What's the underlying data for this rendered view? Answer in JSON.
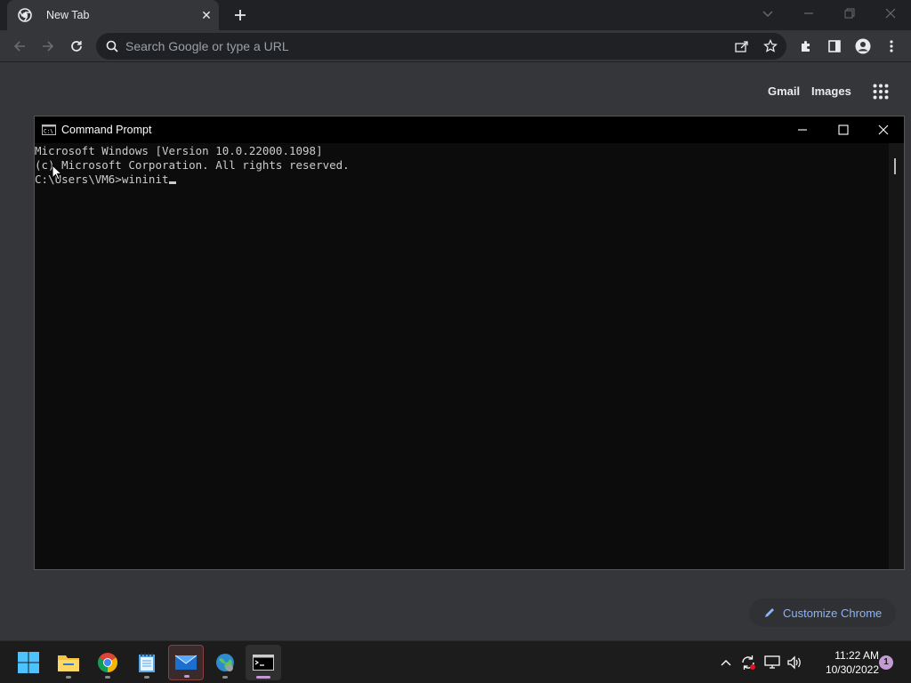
{
  "browser": {
    "tab": {
      "title": "New Tab"
    },
    "omnibox": {
      "placeholder": "Search Google or type a URL"
    },
    "ntp": {
      "gmail": "Gmail",
      "images": "Images",
      "customize_label": "Customize Chrome"
    }
  },
  "cmd": {
    "title": "Command Prompt",
    "lines": [
      "Microsoft Windows [Version 10.0.22000.1098]",
      "(c) Microsoft Corporation. All rights reserved.",
      "C:\\Users\\VM6>wininit"
    ]
  },
  "taskbar": {
    "apps": [
      "start-button",
      "file-explorer",
      "chrome",
      "notepad",
      "mail",
      "control-panel",
      "command-prompt"
    ],
    "clock": {
      "time": "11:22 AM",
      "date": "10/30/2022"
    },
    "notification_count": "1"
  },
  "colors": {
    "accent": "#8ab4f8",
    "taskbar_indicator": "#c39bd3"
  }
}
